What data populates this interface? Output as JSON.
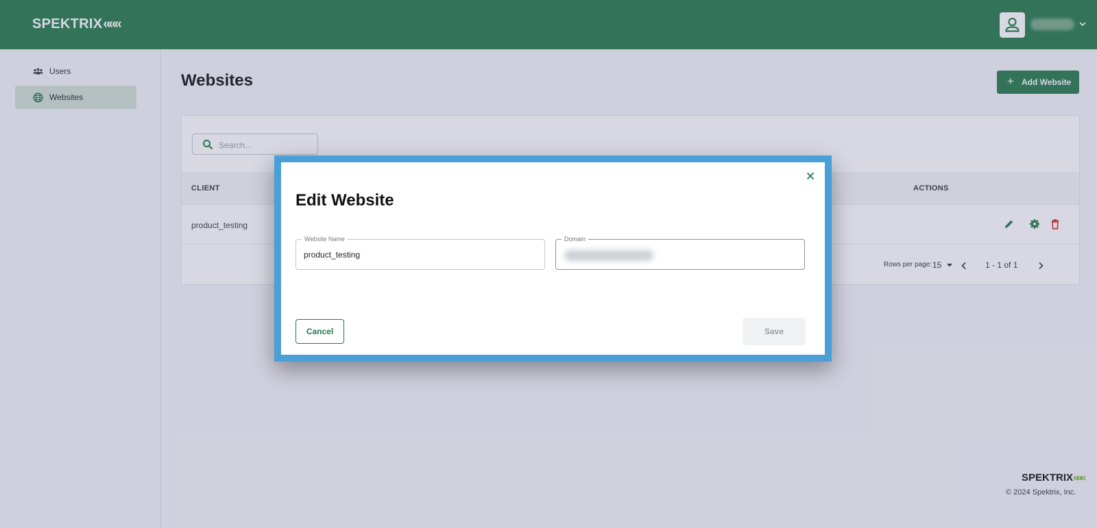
{
  "header": {
    "logo_text": "SPEKTRIX",
    "logo_mark": "«««",
    "user_icon": "user-icon",
    "chevron_icon": "chevron-down-icon"
  },
  "sidebar": {
    "items": [
      {
        "label": "Users",
        "icon": "users-icon",
        "active": false
      },
      {
        "label": "Websites",
        "icon": "globe-icon",
        "active": true
      }
    ]
  },
  "main": {
    "title": "Websites",
    "add_button_label": "Add Website",
    "search_placeholder": "Search...",
    "table": {
      "columns": [
        "CLIENT",
        "ACTIONS"
      ],
      "rows": [
        {
          "client": "product_testing",
          "actions": [
            "edit-icon",
            "settings-icon",
            "delete-icon"
          ]
        }
      ]
    },
    "pagination": {
      "rows_per_page_label": "Rows per page:",
      "rows_per_page_value": "15",
      "range": "1 - 1 of 1"
    }
  },
  "footer": {
    "logo_text": "SPEKTRIX",
    "logo_mark": "«««",
    "copyright": "© 2024 Spektrix, Inc."
  },
  "dialog": {
    "title": "Edit Website",
    "website_name_label": "Website Name",
    "website_name_value": "product_testing",
    "domain_label": "Domain",
    "cancel_label": "Cancel",
    "save_label": "Save"
  },
  "colors": {
    "brand_green": "#23794a",
    "dialog_frame": "#4a9fd6",
    "danger": "#d32f2f",
    "logo_accent": "#7cb83b"
  }
}
